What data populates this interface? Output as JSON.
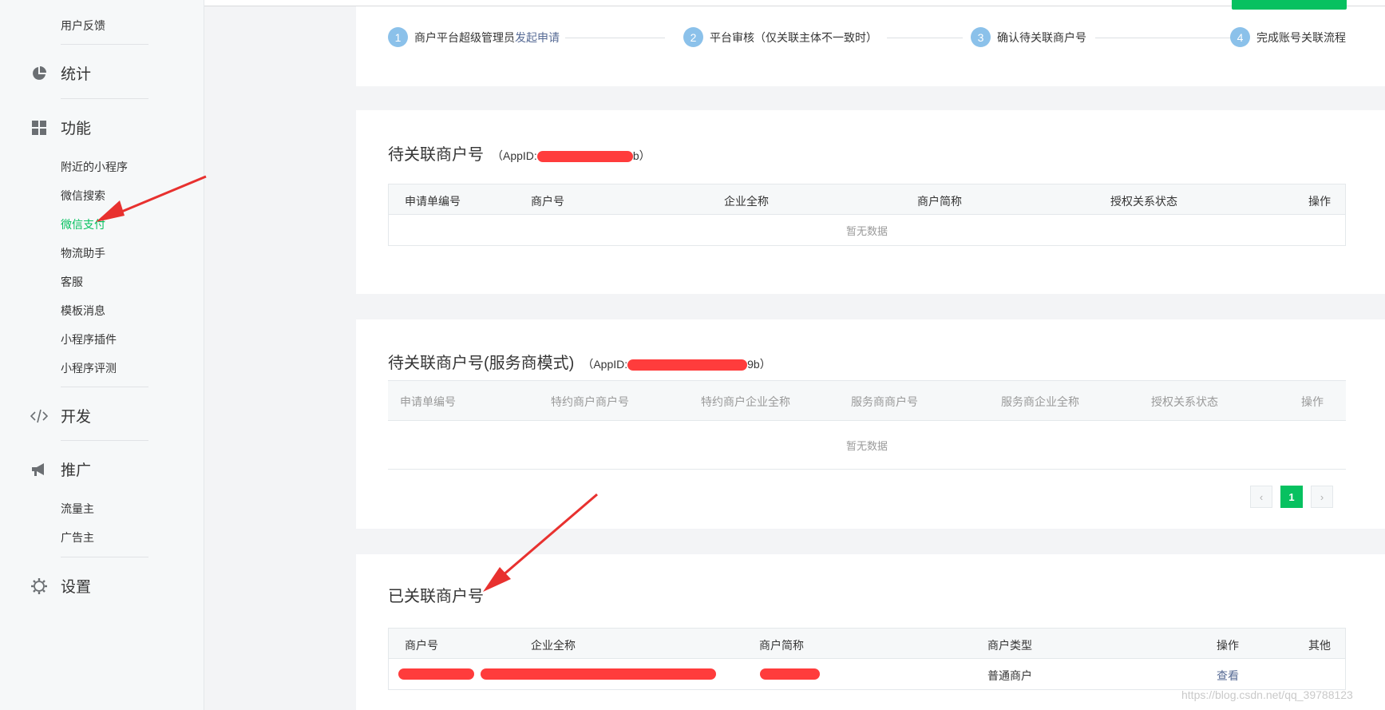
{
  "sidebar": {
    "feedback": "用户反馈",
    "stats": "统计",
    "features": "功能",
    "feature_items": [
      "附近的小程序",
      "微信搜索",
      "微信支付",
      "物流助手",
      "客服",
      "模板消息",
      "小程序插件",
      "小程序评测"
    ],
    "develop": "开发",
    "promote": "推广",
    "promote_items": [
      "流量主",
      "广告主"
    ],
    "settings": "设置"
  },
  "steps": [
    {
      "num": "1",
      "text": "商户平台超级管理员",
      "link": "发起申请"
    },
    {
      "num": "2",
      "text": "平台审核（仅关联主体不一致时）",
      "link": ""
    },
    {
      "num": "3",
      "text": "确认待关联商户号",
      "link": ""
    },
    {
      "num": "4",
      "text": "完成账号关联流程",
      "link": ""
    }
  ],
  "pending": {
    "title": "待关联商户号",
    "appid_prefix": "（AppID:",
    "appid_suffix": "b）",
    "columns": [
      "申请单编号",
      "商户号",
      "企业全称",
      "商户简称",
      "授权关系状态",
      "操作"
    ],
    "empty": "暂无数据"
  },
  "pending_sp": {
    "title": "待关联商户号(服务商模式)",
    "appid_prefix": "（AppID:",
    "appid_suffix": "9b）",
    "columns": [
      "申请单编号",
      "特约商户商户号",
      "特约商户企业全称",
      "服务商商户号",
      "服务商企业全称",
      "授权关系状态",
      "操作"
    ],
    "empty": "暂无数据"
  },
  "pager": {
    "prev": "‹",
    "current": "1",
    "next": "›"
  },
  "linked": {
    "title": "已关联商户号",
    "columns": [
      "商户号",
      "企业全称",
      "商户简称",
      "商户类型",
      "操作",
      "其他"
    ],
    "row": {
      "type": "普通商户",
      "action": "查看"
    }
  },
  "watermark": "https://blog.csdn.net/qq_39788123",
  "colors": {
    "accent": "#07c160",
    "link": "#576b95",
    "step": "#8bc1ea",
    "redaction": "#ff2b2b",
    "annotation_arrow": "#e8312f"
  }
}
